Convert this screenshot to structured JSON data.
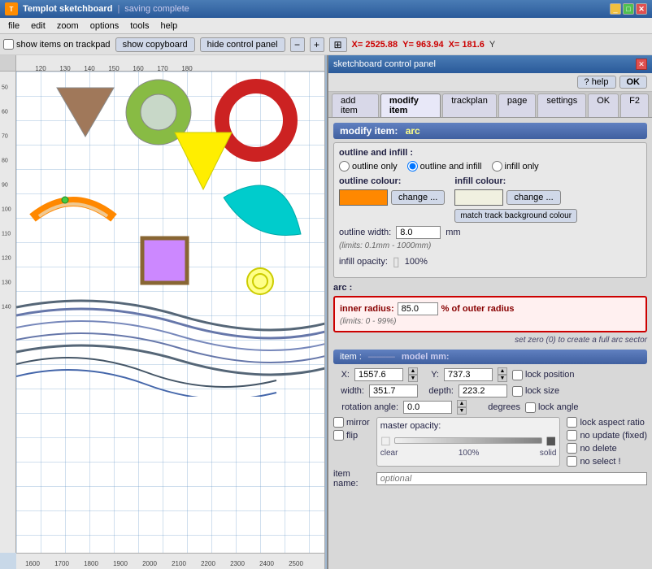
{
  "titlebar": {
    "icon_label": "T",
    "title": "Templot  sketchboard",
    "separator": "|",
    "status": "saving complete"
  },
  "menubar": {
    "items": [
      "file",
      "edit",
      "zoom",
      "options",
      "tools",
      "help"
    ]
  },
  "toolbar": {
    "show_trackpad": "show items on trackpad",
    "show_copyboard": "show copyboard",
    "hide_control": "hide control panel",
    "coord_x": "X= 2525.88",
    "coord_y": "Y= 963.94",
    "coord_x2": "X= 181.6",
    "coord_y2": "Y"
  },
  "canvas": {
    "ruler_h_ticks": [
      "120",
      "130",
      "140",
      "150",
      "160",
      "170",
      "180"
    ],
    "ruler_v_ticks": [
      "50",
      "60",
      "70",
      "80",
      "90",
      "100",
      "110",
      "120",
      "130",
      "140"
    ],
    "bottom_ruler_ticks": [
      "1600",
      "1700",
      "1800",
      "1900",
      "2000",
      "2100",
      "2200",
      "2300",
      "2400",
      "2500"
    ]
  },
  "control_panel": {
    "title": "sketchboard  control  panel",
    "help_btn": "? help",
    "ok_btn": "OK",
    "tabs": [
      "add item",
      "modify item",
      "trackplan",
      "page",
      "settings",
      "OK",
      "F2"
    ],
    "active_tab": "modify item",
    "modify_item_header": "modify item:",
    "modify_item_type": "arc",
    "outline_infill": {
      "section_label": "outline and infill :",
      "outline_only": "outline only",
      "outline_and_infill": "outline and infill",
      "infill_only": "infill only",
      "selected": "outline_and_infill",
      "outline_colour_label": "outline colour:",
      "change_btn": "change ...",
      "infill_colour_label": "infill colour:",
      "change_btn2": "change ...",
      "match_btn": "match track background colour",
      "outline_width_label": "outline width:",
      "outline_width_value": "8.0",
      "outline_width_unit": "mm",
      "outline_width_hint": "(limits: 0.1mm - 1000mm)",
      "infill_opacity_label": "infill opacity:",
      "infill_opacity_pct": "100%"
    },
    "arc": {
      "section_label": "arc :",
      "inner_radius_label": "inner radius:",
      "inner_radius_value": "85.0",
      "inner_radius_suffix": "% of outer radius",
      "inner_radius_hint": "(limits: 0 - 99%)",
      "arc_note": "set zero (0) to create a full arc sector"
    },
    "item": {
      "section_label": "item :",
      "model_mm": "model mm:",
      "x_label": "X:",
      "x_value": "1557.6",
      "y_label": "Y:",
      "y_value": "737.3",
      "width_label": "width:",
      "width_value": "351.7",
      "depth_label": "depth:",
      "depth_value": "223.2",
      "rotation_label": "rotation angle:",
      "rotation_value": "0.0",
      "rotation_unit": "degrees",
      "lock_position": "lock position",
      "lock_size": "lock size",
      "lock_angle": "lock angle",
      "lock_aspect": "lock aspect ratio",
      "mirror": "mirror",
      "flip": "flip",
      "no_update": "no update (fixed)",
      "no_delete": "no delete",
      "no_select": "no select !",
      "opacity_label": "master opacity:",
      "opacity_clear": "clear",
      "opacity_pct": "100%",
      "opacity_solid": "solid",
      "item_name_label": "item name:",
      "item_name_placeholder": "optional"
    }
  }
}
